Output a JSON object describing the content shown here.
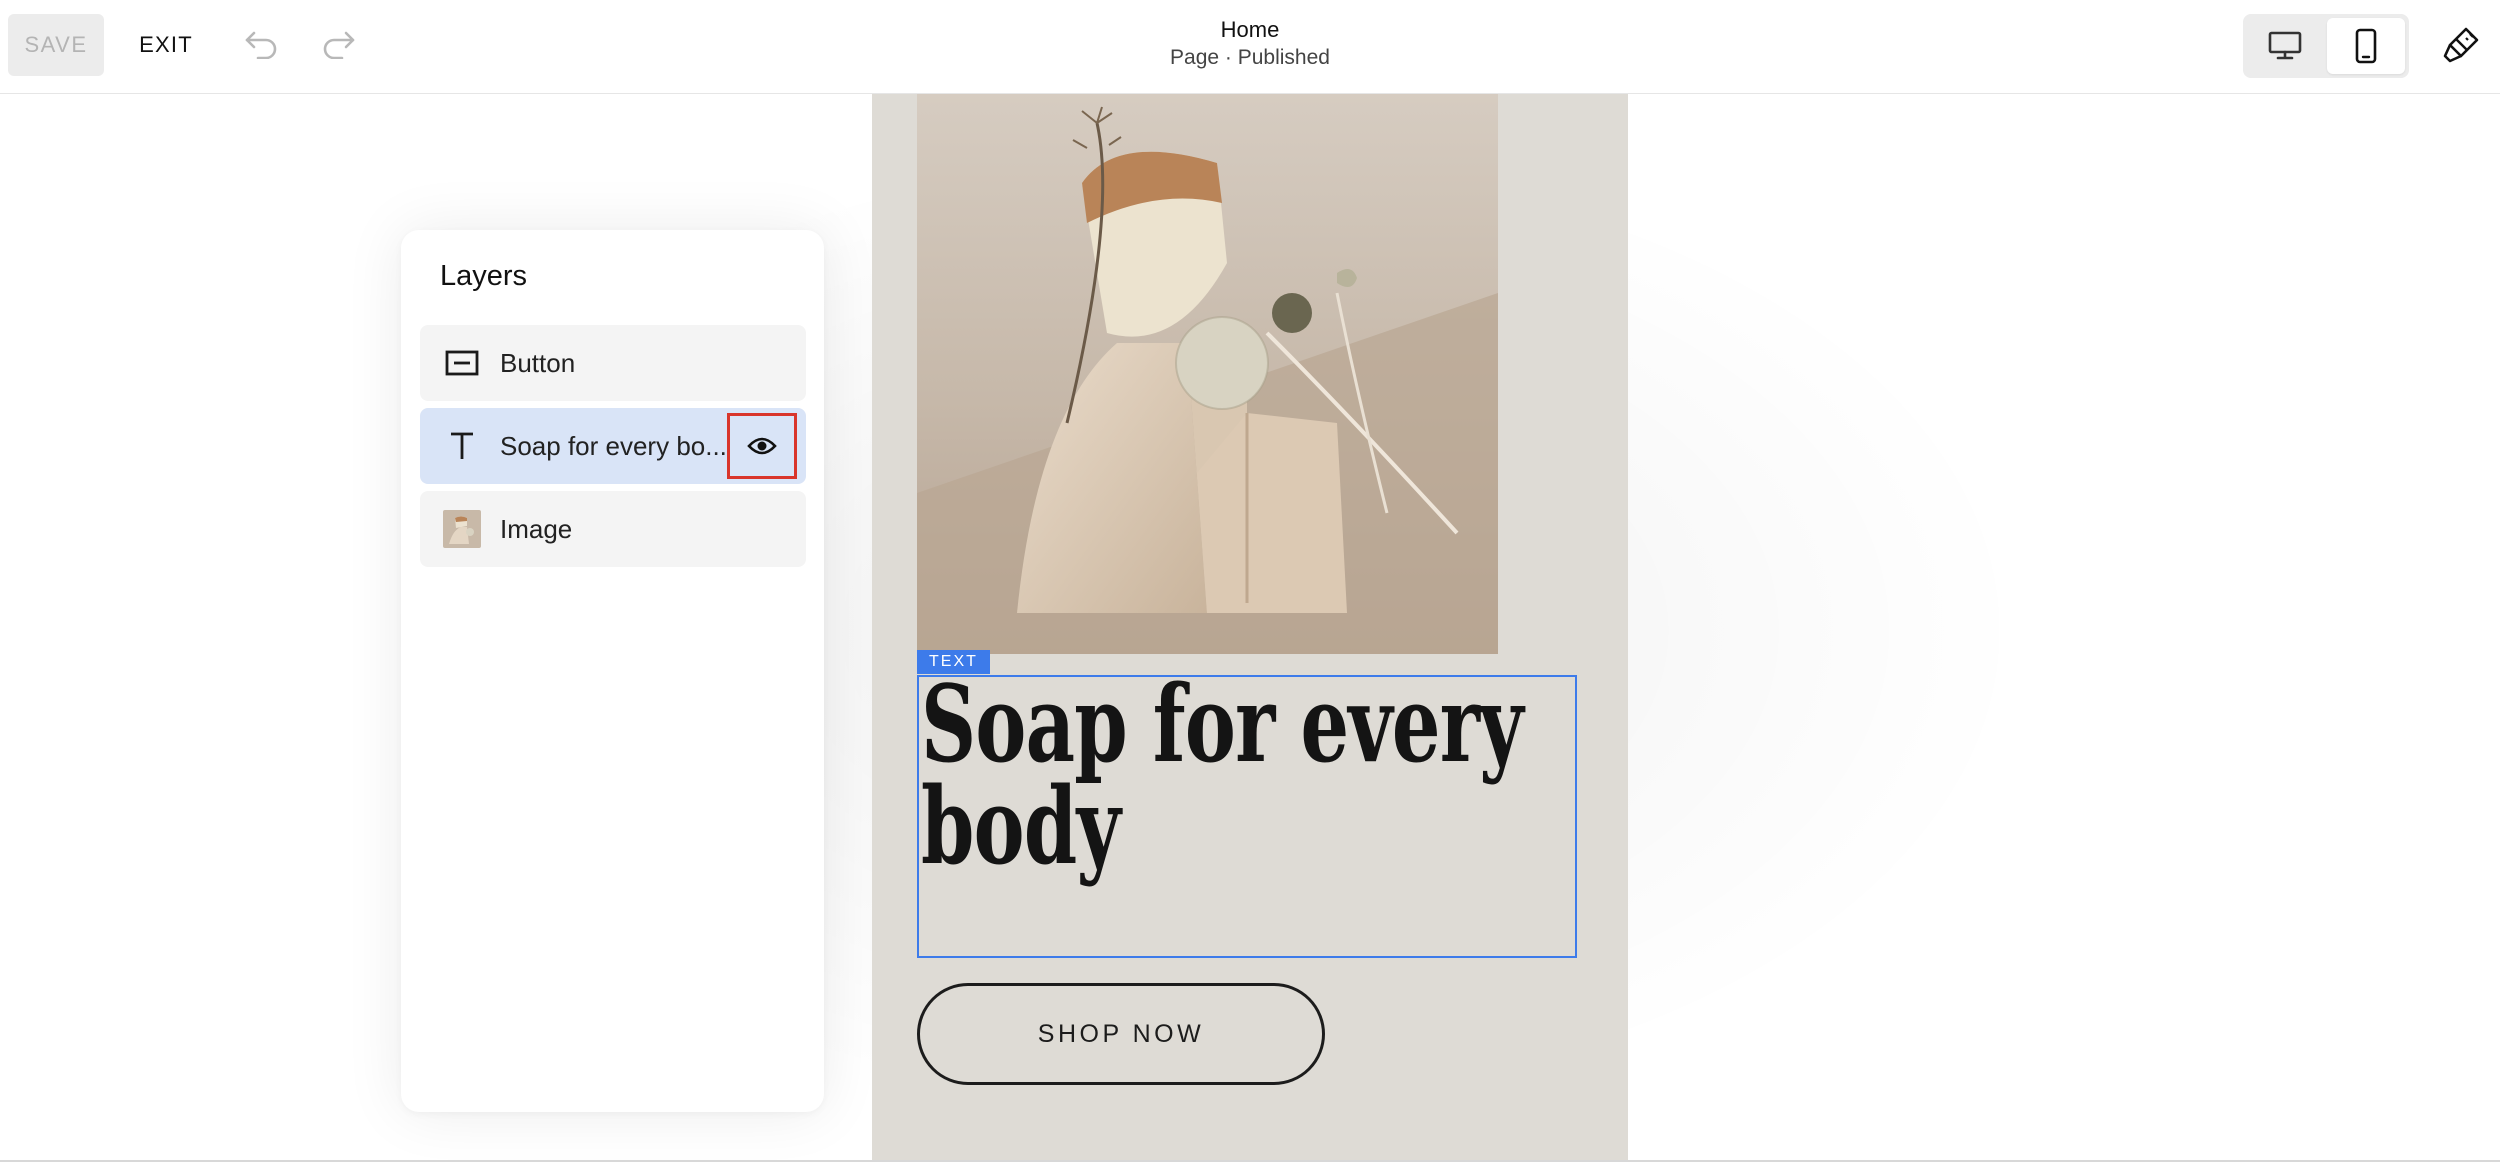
{
  "toolbar": {
    "save_label": "SAVE",
    "exit_label": "EXIT",
    "undo_icon": "undo-icon",
    "redo_icon": "redo-icon"
  },
  "page": {
    "title": "Home",
    "subtitle": "Page · Published"
  },
  "view_toggle": {
    "options": [
      "desktop",
      "mobile"
    ],
    "selected": "mobile"
  },
  "layers": {
    "title": "Layers",
    "items": [
      {
        "icon": "button-layer-icon",
        "label": "Button"
      },
      {
        "icon": "text-layer-icon",
        "label": "Soap for every bo...",
        "selected": true
      },
      {
        "icon": "image-thumbnail-icon",
        "label": "Image"
      }
    ]
  },
  "preview": {
    "text_tag": "TEXT",
    "headline_line1": "Soap for  every",
    "headline_line2": "body",
    "button_label": "SHOP NOW"
  },
  "colors": {
    "selection_blue": "#3d7bea",
    "highlight_red": "#d9352b",
    "selected_layer_bg": "#d9e4f7",
    "preview_bg": "#dedbd5"
  }
}
